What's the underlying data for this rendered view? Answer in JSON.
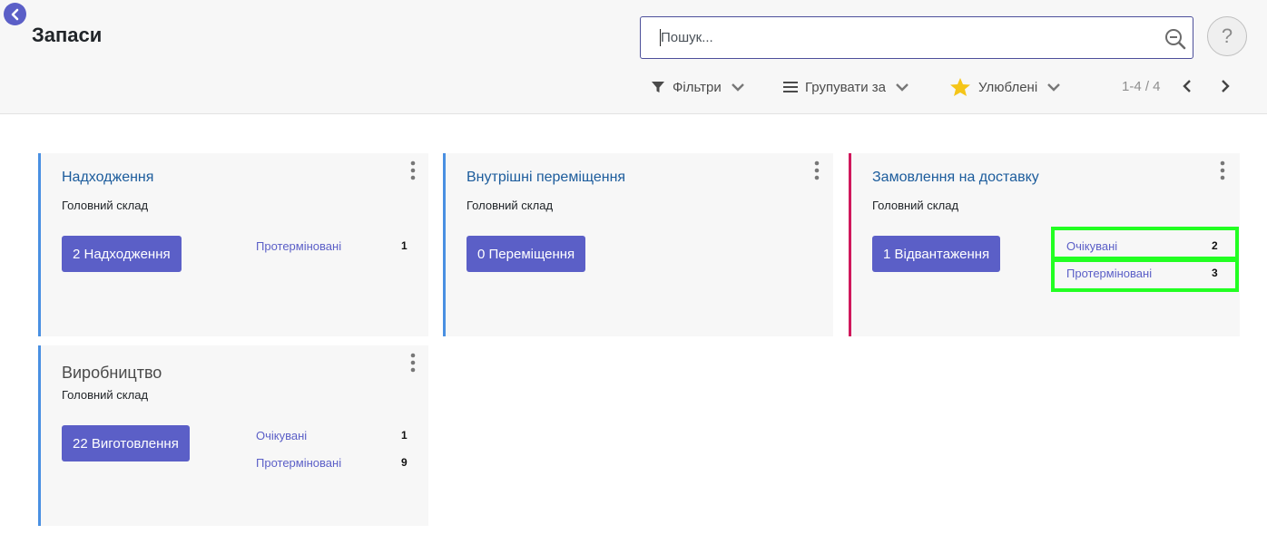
{
  "header": {
    "title": "Запаси",
    "search_placeholder": "Пошук...",
    "help_label": "?"
  },
  "toolbar": {
    "filters_label": "Фільтри",
    "group_by_label": "Групувати за",
    "favorites_label": "Улюблені",
    "pager_value": "1-4 / 4"
  },
  "colors": {
    "accent": "#5b5fc7",
    "blue_border": "#4a90e2",
    "pink_border": "#d0185c",
    "highlight": "#22ff22",
    "star": "#f5c518"
  },
  "cards": [
    {
      "title": "Надходження",
      "subtitle": "Головний склад",
      "button_label": "2 Надходження",
      "stats": [
        {
          "label": "Протерміновані",
          "count": "1"
        }
      ]
    },
    {
      "title": "Внутрішні переміщення",
      "subtitle": "Головний склад",
      "button_label": "0 Переміщення",
      "stats": []
    },
    {
      "title": "Замовлення на доставку",
      "subtitle": "Головний склад",
      "button_label": "1 Відвантаження",
      "stats": [
        {
          "label": "Очікувані",
          "count": "2"
        },
        {
          "label": "Протерміновані",
          "count": "3"
        }
      ]
    },
    {
      "title": "Виробництво",
      "subtitle": "Головний склад",
      "button_label": "22 Виготовлення",
      "stats": [
        {
          "label": "Очікувані",
          "count": "1"
        },
        {
          "label": "Протерміновані",
          "count": "9"
        }
      ]
    }
  ]
}
